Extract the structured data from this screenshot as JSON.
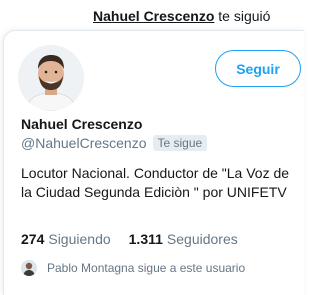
{
  "notification": {
    "user": "Nahuel Crescenzo",
    "action": "te siguió"
  },
  "profile": {
    "name": "Nahuel Crescenzo",
    "handle": "@NahuelCrescenzo",
    "follows_you_badge": "Te sigue",
    "bio": "Locutor Nacional. Conductor de \"La Voz de la Ciudad Segunda Ediciòn \" por UNIFETV",
    "following_count": "274",
    "following_label": "Siguiendo",
    "followers_count": "1.311",
    "followers_label": "Seguidores",
    "followed_by_text": "Pablo Montagna sigue a este usuario"
  },
  "actions": {
    "follow_label": "Seguir"
  },
  "colors": {
    "accent": "#1da1f2",
    "secondary_text": "#657786",
    "badge_bg": "#e6ecf0"
  },
  "icons": {
    "avatar": "profile-photo",
    "follower_avatar": "profile-photo-small"
  }
}
